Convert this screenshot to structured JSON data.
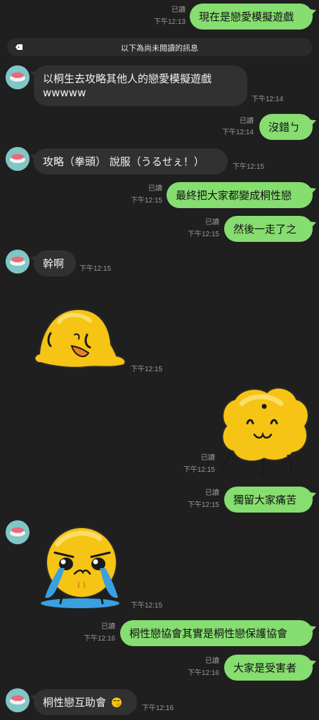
{
  "divider": {
    "text": "以下為尚未閱讀的訊息",
    "icon": "arrow-label-icon"
  },
  "messages": [
    {
      "side": "out",
      "text": "現在是戀愛模擬遊戲",
      "read": "已讀",
      "time": "下午12:13"
    },
    {
      "side": "in",
      "line1": "以桐生去攻略其他人的戀愛模擬遊戲",
      "line2": "wwwww",
      "time": "下午12:14"
    },
    {
      "side": "out",
      "text": "沒錯ㄅ",
      "read": "已讀",
      "time": "下午12:14"
    },
    {
      "side": "in",
      "text": "攻略（拳頭） 說服（うるせぇ！）",
      "time": "下午12:15"
    },
    {
      "side": "out",
      "text": "最終把大家都變成桐性戀",
      "read": "已讀",
      "time": "下午12:15"
    },
    {
      "side": "out",
      "text": "然後一走了之",
      "read": "已讀",
      "time": "下午12:15"
    },
    {
      "side": "in",
      "text": "幹啊",
      "time": "下午12:15"
    },
    {
      "side": "in",
      "sticker": "melting-blob-sticker",
      "time": "下午12:15"
    },
    {
      "side": "out",
      "sticker": "smug-blob-sticker",
      "read": "已讀",
      "time": "下午12:15"
    },
    {
      "side": "out",
      "text": "獨留大家痛苦",
      "read": "已讀",
      "time": "下午12:15"
    },
    {
      "side": "in",
      "sticker": "crying-blob-sticker",
      "time": "下午12:15"
    },
    {
      "side": "out",
      "text": "桐性戀協會其實是桐性戀保護協會",
      "read": "已讀",
      "time": "下午12:16"
    },
    {
      "side": "out",
      "text": "大家是受害者",
      "read": "已讀",
      "time": "下午12:16"
    },
    {
      "side": "in",
      "text": "桐性戀互助會",
      "emoji": "🤭",
      "time": "下午12:16"
    }
  ],
  "colors": {
    "background": "#1f1f1f",
    "outgoing_bubble": "#86dd70",
    "incoming_bubble": "#313131",
    "meta_text": "#9a9a9a",
    "avatar": "#7fc6c6"
  }
}
